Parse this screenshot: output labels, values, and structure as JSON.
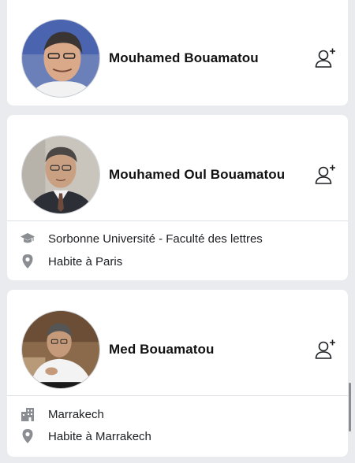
{
  "results": [
    {
      "name": "Mouhamed Bouamatou",
      "details": []
    },
    {
      "name": "Mouhamed Oul Bouamatou",
      "details": [
        {
          "icon": "graduation-cap-icon",
          "text": "Sorbonne Université - Faculté des lettres"
        },
        {
          "icon": "location-pin-icon",
          "text": "Habite à Paris"
        }
      ]
    },
    {
      "name": "Med Bouamatou",
      "details": [
        {
          "icon": "city-icon",
          "text": "Marrakech"
        },
        {
          "icon": "location-pin-icon",
          "text": "Habite à Marrakech"
        }
      ]
    }
  ],
  "colors": {
    "background": "#e9ebee",
    "card": "#ffffff",
    "icon_gray": "#8a8d91",
    "text": "#1c1e21"
  }
}
